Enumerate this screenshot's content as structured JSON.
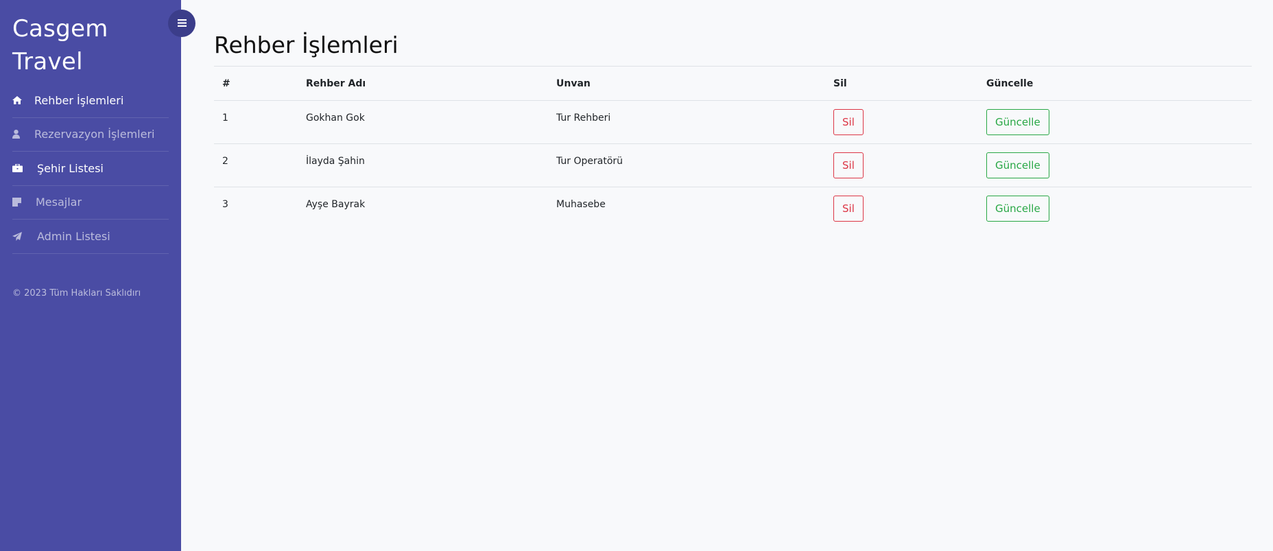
{
  "sidebar": {
    "brand_line1": "Casgem",
    "brand_line2": "Travel",
    "items": [
      {
        "label": "Rehber İşlemleri",
        "icon": "home-icon"
      },
      {
        "label": "Rezervazyon İşlemleri",
        "icon": "user-icon"
      },
      {
        "label": "Şehir Listesi",
        "icon": "briefcase-icon"
      },
      {
        "label": "Mesajlar",
        "icon": "sticky-note-icon"
      },
      {
        "label": "Admin Listesi",
        "icon": "paper-plane-icon"
      }
    ],
    "footer": "© 2023 Tüm Hakları Saklıdırı"
  },
  "main": {
    "title": "Rehber İşlemleri",
    "table": {
      "headers": [
        "#",
        "Rehber Adı",
        "Unvan",
        "Sil",
        "Güncelle"
      ],
      "rows": [
        {
          "id": "1",
          "name": "Gokhan Gok",
          "title": "Tur Rehberi",
          "delete": "Sil",
          "update": "Güncelle"
        },
        {
          "id": "2",
          "name": "İlayda Şahin",
          "title": "Tur Operatörü",
          "delete": "Sil",
          "update": "Güncelle"
        },
        {
          "id": "3",
          "name": "Ayşe Bayrak",
          "title": "Muhasebe",
          "delete": "Sil",
          "update": "Güncelle"
        }
      ]
    }
  },
  "colors": {
    "sidebar_bg": "#4a4ca4",
    "toggle_bg": "#3b3d8a",
    "delete": "#dc3545",
    "update": "#28a745"
  }
}
